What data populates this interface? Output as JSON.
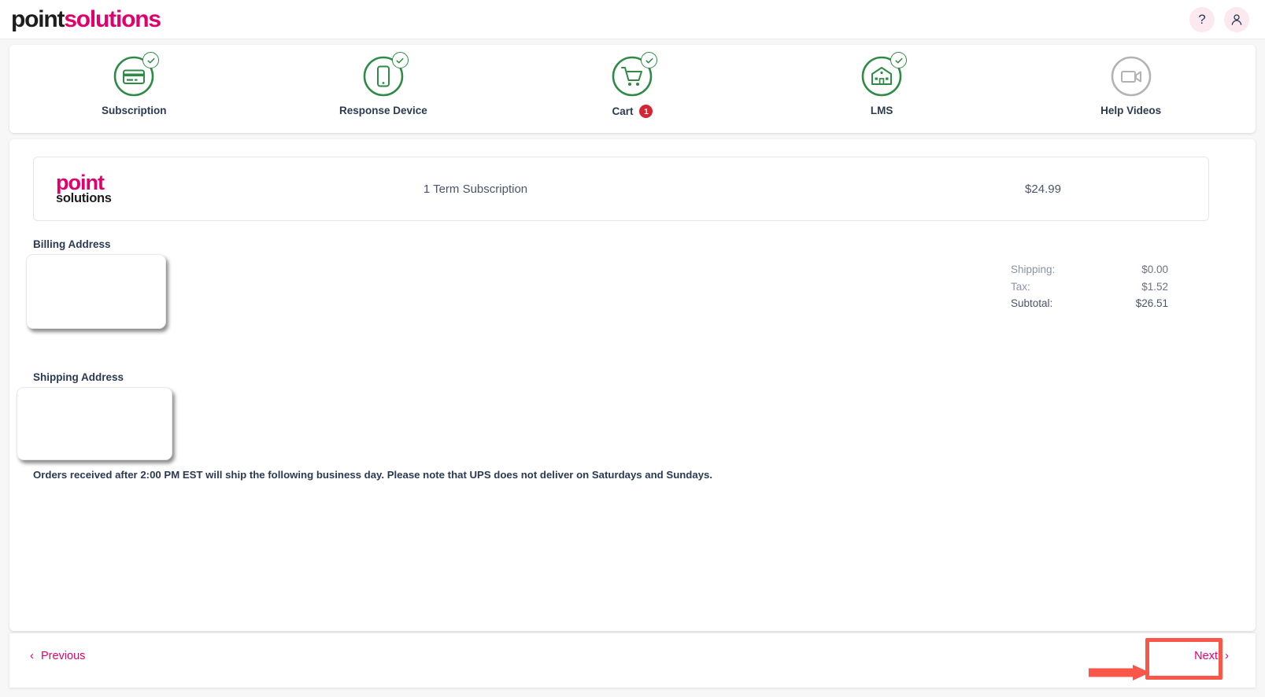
{
  "header": {
    "brand_first": "point",
    "brand_second": "solutions",
    "brand_color_first": "#1d1d1d",
    "brand_color_second": "#e0006c",
    "actions": [
      {
        "name": "help-button",
        "icon": "question-mark-icon",
        "label": "?"
      },
      {
        "name": "account-button",
        "icon": "user-icon",
        "label": ""
      }
    ]
  },
  "stepper": {
    "steps": [
      {
        "label": "Subscription",
        "icon": "credit-card-icon",
        "state": "complete",
        "badge": null
      },
      {
        "label": "Response Device",
        "icon": "mobile-device-icon",
        "state": "complete",
        "badge": null
      },
      {
        "label": "Cart",
        "icon": "shopping-cart-icon",
        "state": "complete",
        "badge": "1"
      },
      {
        "label": "LMS",
        "icon": "school-building-icon",
        "state": "complete",
        "badge": null
      },
      {
        "label": "Help Videos",
        "icon": "video-camera-icon",
        "state": "inactive",
        "badge": null
      }
    ],
    "complete_color": "#2f8a46",
    "inactive_color": "#b3b3b3",
    "badge_color": "#d32535"
  },
  "product": {
    "logo_first": "point",
    "logo_second": "solutions",
    "name": "1 Term Subscription",
    "price": "$24.99"
  },
  "billing": {
    "label": "Billing Address",
    "value": ""
  },
  "shipping": {
    "label": "Shipping Address",
    "value": ""
  },
  "totals": [
    {
      "key": "Shipping:",
      "value": "$0.00"
    },
    {
      "key": "Tax:",
      "value": "$1.52"
    },
    {
      "key": "Subtotal:",
      "value": "$26.51"
    }
  ],
  "notice": "Orders received after 2:00 PM EST will ship the following business day. Please note that UPS does not deliver on Saturdays and Sundays.",
  "footer": {
    "previous_label": "Previous",
    "next_label": "Next",
    "link_color": "#e0006c"
  },
  "annotation": {
    "highlight_target": "Next",
    "color": "#f9574a"
  }
}
